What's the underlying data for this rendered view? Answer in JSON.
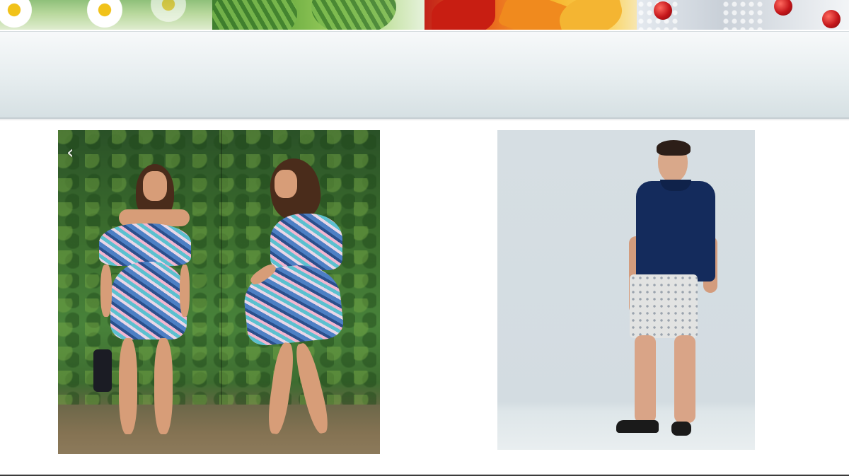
{
  "banner": {
    "seasons": [
      "spring",
      "summer",
      "autumn",
      "winter"
    ]
  },
  "carousel": {
    "prev_icon": "chevron-left-icon",
    "prev_glyph": "‹"
  },
  "colors": {
    "header_gradient_top": "#f7f9fa",
    "header_gradient_bottom": "#d6e0e3",
    "polo": "#142b5c",
    "backdrop": "#d6dee3"
  }
}
